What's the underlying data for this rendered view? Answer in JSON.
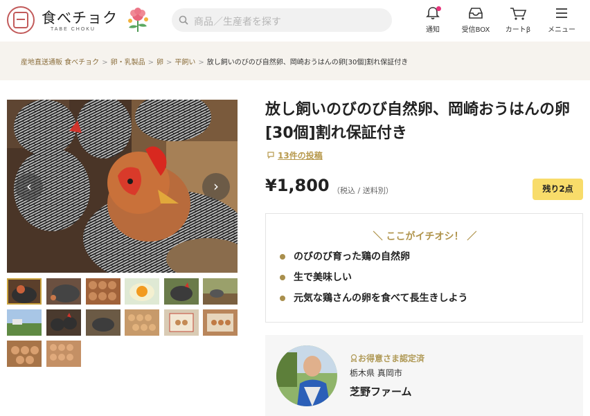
{
  "header": {
    "logo_text": "食べチョク",
    "logo_sub": "TABE CHOKU",
    "search_placeholder": "商品／生産者を探す",
    "nav": [
      {
        "label": "通知",
        "icon": "bell-icon"
      },
      {
        "label": "受信BOX",
        "icon": "inbox-icon"
      },
      {
        "label": "カートβ",
        "icon": "cart-icon"
      },
      {
        "label": "メニュー",
        "icon": "menu-icon"
      }
    ]
  },
  "breadcrumb": {
    "items": [
      "産地直送通販 食べチョク",
      "卵・乳製品",
      "卵",
      "平飼い"
    ],
    "current": "放し飼いのびのび自然卵、岡崎おうはんの卵[30個]割れ保証付き",
    "separator": ">"
  },
  "gallery": {
    "prev_arrow": "‹",
    "next_arrow": "›",
    "thumbnail_count": 14,
    "selected_index": 0
  },
  "product": {
    "title": "放し飼いのびのび自然卵、岡崎おうはんの卵[30個]割れ保証付き",
    "posts_link": "13件の投稿",
    "price": "¥1,800",
    "price_note": "（税込 / 送料別）",
    "stock_badge": "残り2点",
    "colors": {
      "accent": "#b0944c",
      "stock_bg": "#f8dc6a",
      "notify_dot": "#e6337a"
    }
  },
  "highlights": {
    "heading": "＼ ここがイチオシ！ ／",
    "items": [
      "のびのび育った鶏の自然卵",
      "生で美味しい",
      "元気な鶏さんの卵を食べて長生きしよう"
    ]
  },
  "seller": {
    "certification": "お得意さま認定済",
    "location": "栃木県 真岡市",
    "name": "芝野ファーム"
  }
}
